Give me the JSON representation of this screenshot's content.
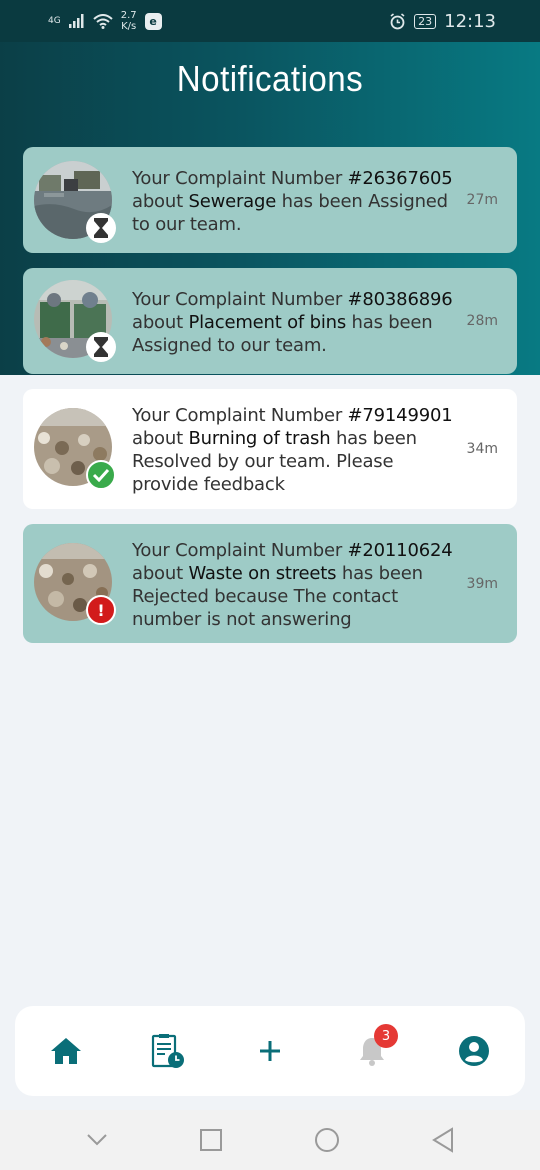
{
  "status_bar": {
    "network": "4G",
    "speed_value": "2.7",
    "speed_unit": "K/s",
    "app_badge": "e",
    "battery": "23",
    "time": "12:13"
  },
  "header": {
    "title": "Notifications"
  },
  "notifications": [
    {
      "prefix": "Your Complaint Number ",
      "number": "#26367605",
      "about": "about ",
      "topic": "Sewerage",
      "rest": " has been Assigned to our team.",
      "time": "27m",
      "status": "pending",
      "status_icon": "hourglass-icon"
    },
    {
      "prefix": "Your Complaint Number ",
      "number": "#80386896",
      "about": "about ",
      "topic": "Placement of bins",
      "rest": " has been Assigned to our team.",
      "time": "28m",
      "status": "pending",
      "status_icon": "hourglass-icon"
    },
    {
      "prefix": "Your Complaint Number ",
      "number": "#79149901",
      "about": "about ",
      "topic": "Burning of trash",
      "rest": " has been Resolved by our team. Please provide feedback",
      "time": "34m",
      "status": "resolved",
      "status_icon": "check-icon"
    },
    {
      "prefix": "Your Complaint Number ",
      "number": "#20110624",
      "about": "about ",
      "topic": "Waste on streets",
      "rest": " has been Rejected because The contact number is not answering",
      "time": "39m",
      "status": "rejected",
      "status_icon": "exclamation-icon",
      "status_glyph": "!"
    }
  ],
  "bottom_nav": {
    "items": [
      "home-icon",
      "complaints-history-icon",
      "add-icon",
      "bell-icon",
      "profile-icon"
    ],
    "notification_count": "3",
    "accent_color": "#0a6e78",
    "inactive_color": "#c8c8c8"
  },
  "colors": {
    "unread_card": "#9ecbc6",
    "read_card": "#ffffff",
    "header_start": "#0b3f47",
    "header_end": "#087a83"
  }
}
